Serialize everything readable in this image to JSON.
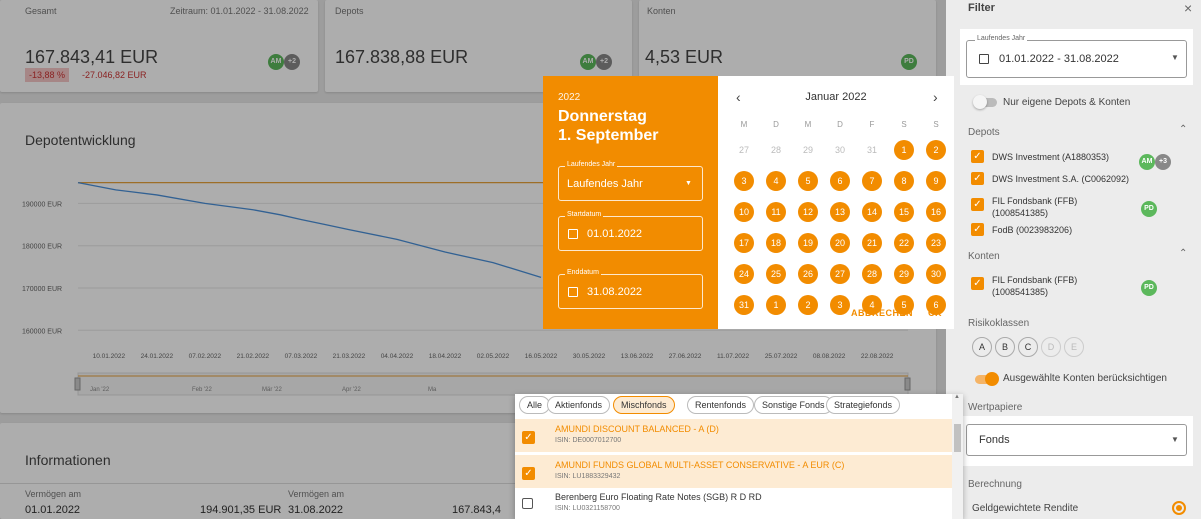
{
  "summary": {
    "gesamt": {
      "label": "Gesamt",
      "period": "Zeitraum: 01.01.2022 - 31.08.2022",
      "value": "167.843,41 EUR",
      "change_pct": "-13,88 %",
      "change_abs": "-27.046,82 EUR",
      "avatar": "AM",
      "extra": "+2"
    },
    "depots": {
      "label": "Depots",
      "value": "167.838,88 EUR",
      "avatar": "AM",
      "extra": "+2"
    },
    "konten": {
      "label": "Konten",
      "value": "4,53 EUR",
      "avatar": "PD"
    }
  },
  "chart_card": {
    "title": "Depotentwicklung"
  },
  "chart_data": {
    "type": "line",
    "title": "Depotentwicklung",
    "y_ticks": [
      "190000 EUR",
      "180000 EUR",
      "170000 EUR",
      "160000 EUR"
    ],
    "ylim": [
      157000,
      196000
    ],
    "x_ticks": [
      "10.01.2022",
      "24.01.2022",
      "07.02.2022",
      "21.02.2022",
      "07.03.2022",
      "21.03.2022",
      "04.04.2022",
      "18.04.2022",
      "02.05.2022",
      "16.05.2022",
      "30.05.2022",
      "13.06.2022",
      "27.06.2022",
      "11.07.2022",
      "25.07.2022",
      "08.08.2022",
      "22.08.2022"
    ],
    "navigator_ticks": [
      "Jan '22",
      "Feb '22",
      "Mär '22",
      "Apr '22",
      "Ma"
    ],
    "series": [
      {
        "color": "#e8a23a",
        "x": [
          "01.01.2022",
          "31.08.2022"
        ],
        "values": [
          194900,
          194900
        ]
      },
      {
        "color": "#4a90d9",
        "x": [
          "01.01.2022",
          "12.01.2022",
          "24.01.2022",
          "07.02.2022",
          "21.02.2022",
          "01.03.2022",
          "07.03.2022",
          "14.03.2022",
          "21.03.2022",
          "04.04.2022",
          "18.04.2022",
          "02.05.2022",
          "16.05.2022"
        ],
        "values": [
          194900,
          193200,
          192000,
          190000,
          188500,
          187300,
          186200,
          185000,
          183800,
          181500,
          178500,
          176000,
          172500
        ]
      }
    ]
  },
  "info_card": {
    "title": "Informationen",
    "v1_label": "Vermögen am",
    "v1_date": "01.01.2022",
    "v1_value": "194.901,35 EUR",
    "v2_label": "Vermögen am",
    "v2_date": "31.08.2022",
    "v2_value": "167.843,4"
  },
  "datepicker": {
    "year": "2022",
    "weekday": "Donnerstag",
    "date": "1. September",
    "range_label": "Laufendes Jahr",
    "range_value": "Laufendes Jahr",
    "start_label": "Startdatum",
    "start_value": "01.01.2022",
    "end_label": "Enddatum",
    "end_value": "31.08.2022",
    "month": "Januar 2022",
    "prev": "‹",
    "next": "›",
    "weekdays": [
      "M",
      "D",
      "M",
      "D",
      "F",
      "S",
      "S"
    ],
    "days": [
      [
        "27",
        "28",
        "29",
        "30",
        "31",
        "1",
        "2"
      ],
      [
        "3",
        "4",
        "5",
        "6",
        "7",
        "8",
        "9"
      ],
      [
        "10",
        "11",
        "12",
        "13",
        "14",
        "15",
        "16"
      ],
      [
        "17",
        "18",
        "19",
        "20",
        "21",
        "22",
        "23"
      ],
      [
        "24",
        "25",
        "26",
        "27",
        "28",
        "29",
        "30"
      ],
      [
        "31",
        "1",
        "2",
        "3",
        "4",
        "5",
        "6"
      ]
    ],
    "cancel": "ABBRECHEN",
    "ok": "OK"
  },
  "fonds_dropdown": {
    "chips": [
      "Alle",
      "Aktienfonds",
      "Mischfonds",
      "Rentenfonds",
      "Sonstige Fonds",
      "Strategiefonds"
    ],
    "selected_chip": "Mischfonds",
    "items": [
      {
        "name": "AMUNDI DISCOUNT BALANCED - A (D)",
        "isin": "ISIN: DE0007012700",
        "checked": true
      },
      {
        "name": "AMUNDI FUNDS GLOBAL MULTI-ASSET CONSERVATIVE - A EUR (C)",
        "isin": "ISIN: LU1883329432",
        "checked": true
      },
      {
        "name": "Berenberg Euro Floating Rate Notes (SGB) R D RD",
        "isin": "ISIN: LU0321158700",
        "checked": false
      }
    ]
  },
  "sidebar": {
    "title": "Filter",
    "close": "×",
    "period_label": "Laufendes Jahr",
    "period_value": "01.01.2022 - 31.08.2022",
    "own_toggle": "Nur eigene Depots & Konten",
    "depots_label": "Depots",
    "depots": [
      {
        "name": "DWS Investment (A1880353)",
        "avatar": "AM",
        "extra": "+3"
      },
      {
        "name": "DWS Investment S.A. (C0062092)"
      },
      {
        "name": "FIL Fondsbank (FFB) (1008541385)",
        "avatar": "PD"
      },
      {
        "name": "FodB (0023983206)"
      }
    ],
    "konten_label": "Konten",
    "konten": [
      {
        "name": "FIL Fondsbank (FFB) (1008541385)",
        "avatar": "PD"
      }
    ],
    "risk_label": "Risikoklassen",
    "risk": [
      "A",
      "B",
      "C",
      "D",
      "E"
    ],
    "selected_toggle": "Ausgewählte Konten berücksichtigen",
    "wp_label": "Wertpapiere",
    "wp_value": "Fonds",
    "calc_label": "Berechnung",
    "calc_value": "Geldgewichtete Rendite"
  },
  "colors": {
    "accent": "#f28c00",
    "line_blue": "#4a90d9",
    "line_orange": "#e8a23a"
  }
}
